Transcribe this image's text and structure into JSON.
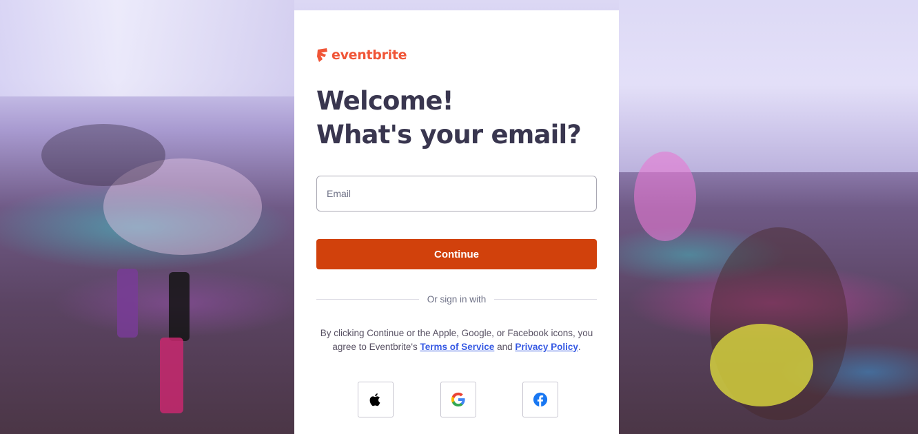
{
  "brand": {
    "name": "eventbrite",
    "color": "#f05537"
  },
  "heading": {
    "line1": "Welcome!",
    "line2": "What's your email?"
  },
  "email": {
    "placeholder": "Email",
    "value": ""
  },
  "continue_label": "Continue",
  "divider_label": "Or sign in with",
  "legal": {
    "prefix": "By clicking Continue or the Apple, Google, or Facebook icons, you agree to Eventbrite's",
    "terms_label": "Terms of Service",
    "conjunction": "and",
    "privacy_label": "Privacy Policy",
    "suffix": "."
  },
  "social": [
    {
      "provider": "Apple",
      "icon": "apple-icon"
    },
    {
      "provider": "Google",
      "icon": "google-icon"
    },
    {
      "provider": "Facebook",
      "icon": "facebook-icon"
    }
  ],
  "colors": {
    "accent": "#d1410c",
    "heading": "#39364f",
    "link": "#3659e3"
  }
}
